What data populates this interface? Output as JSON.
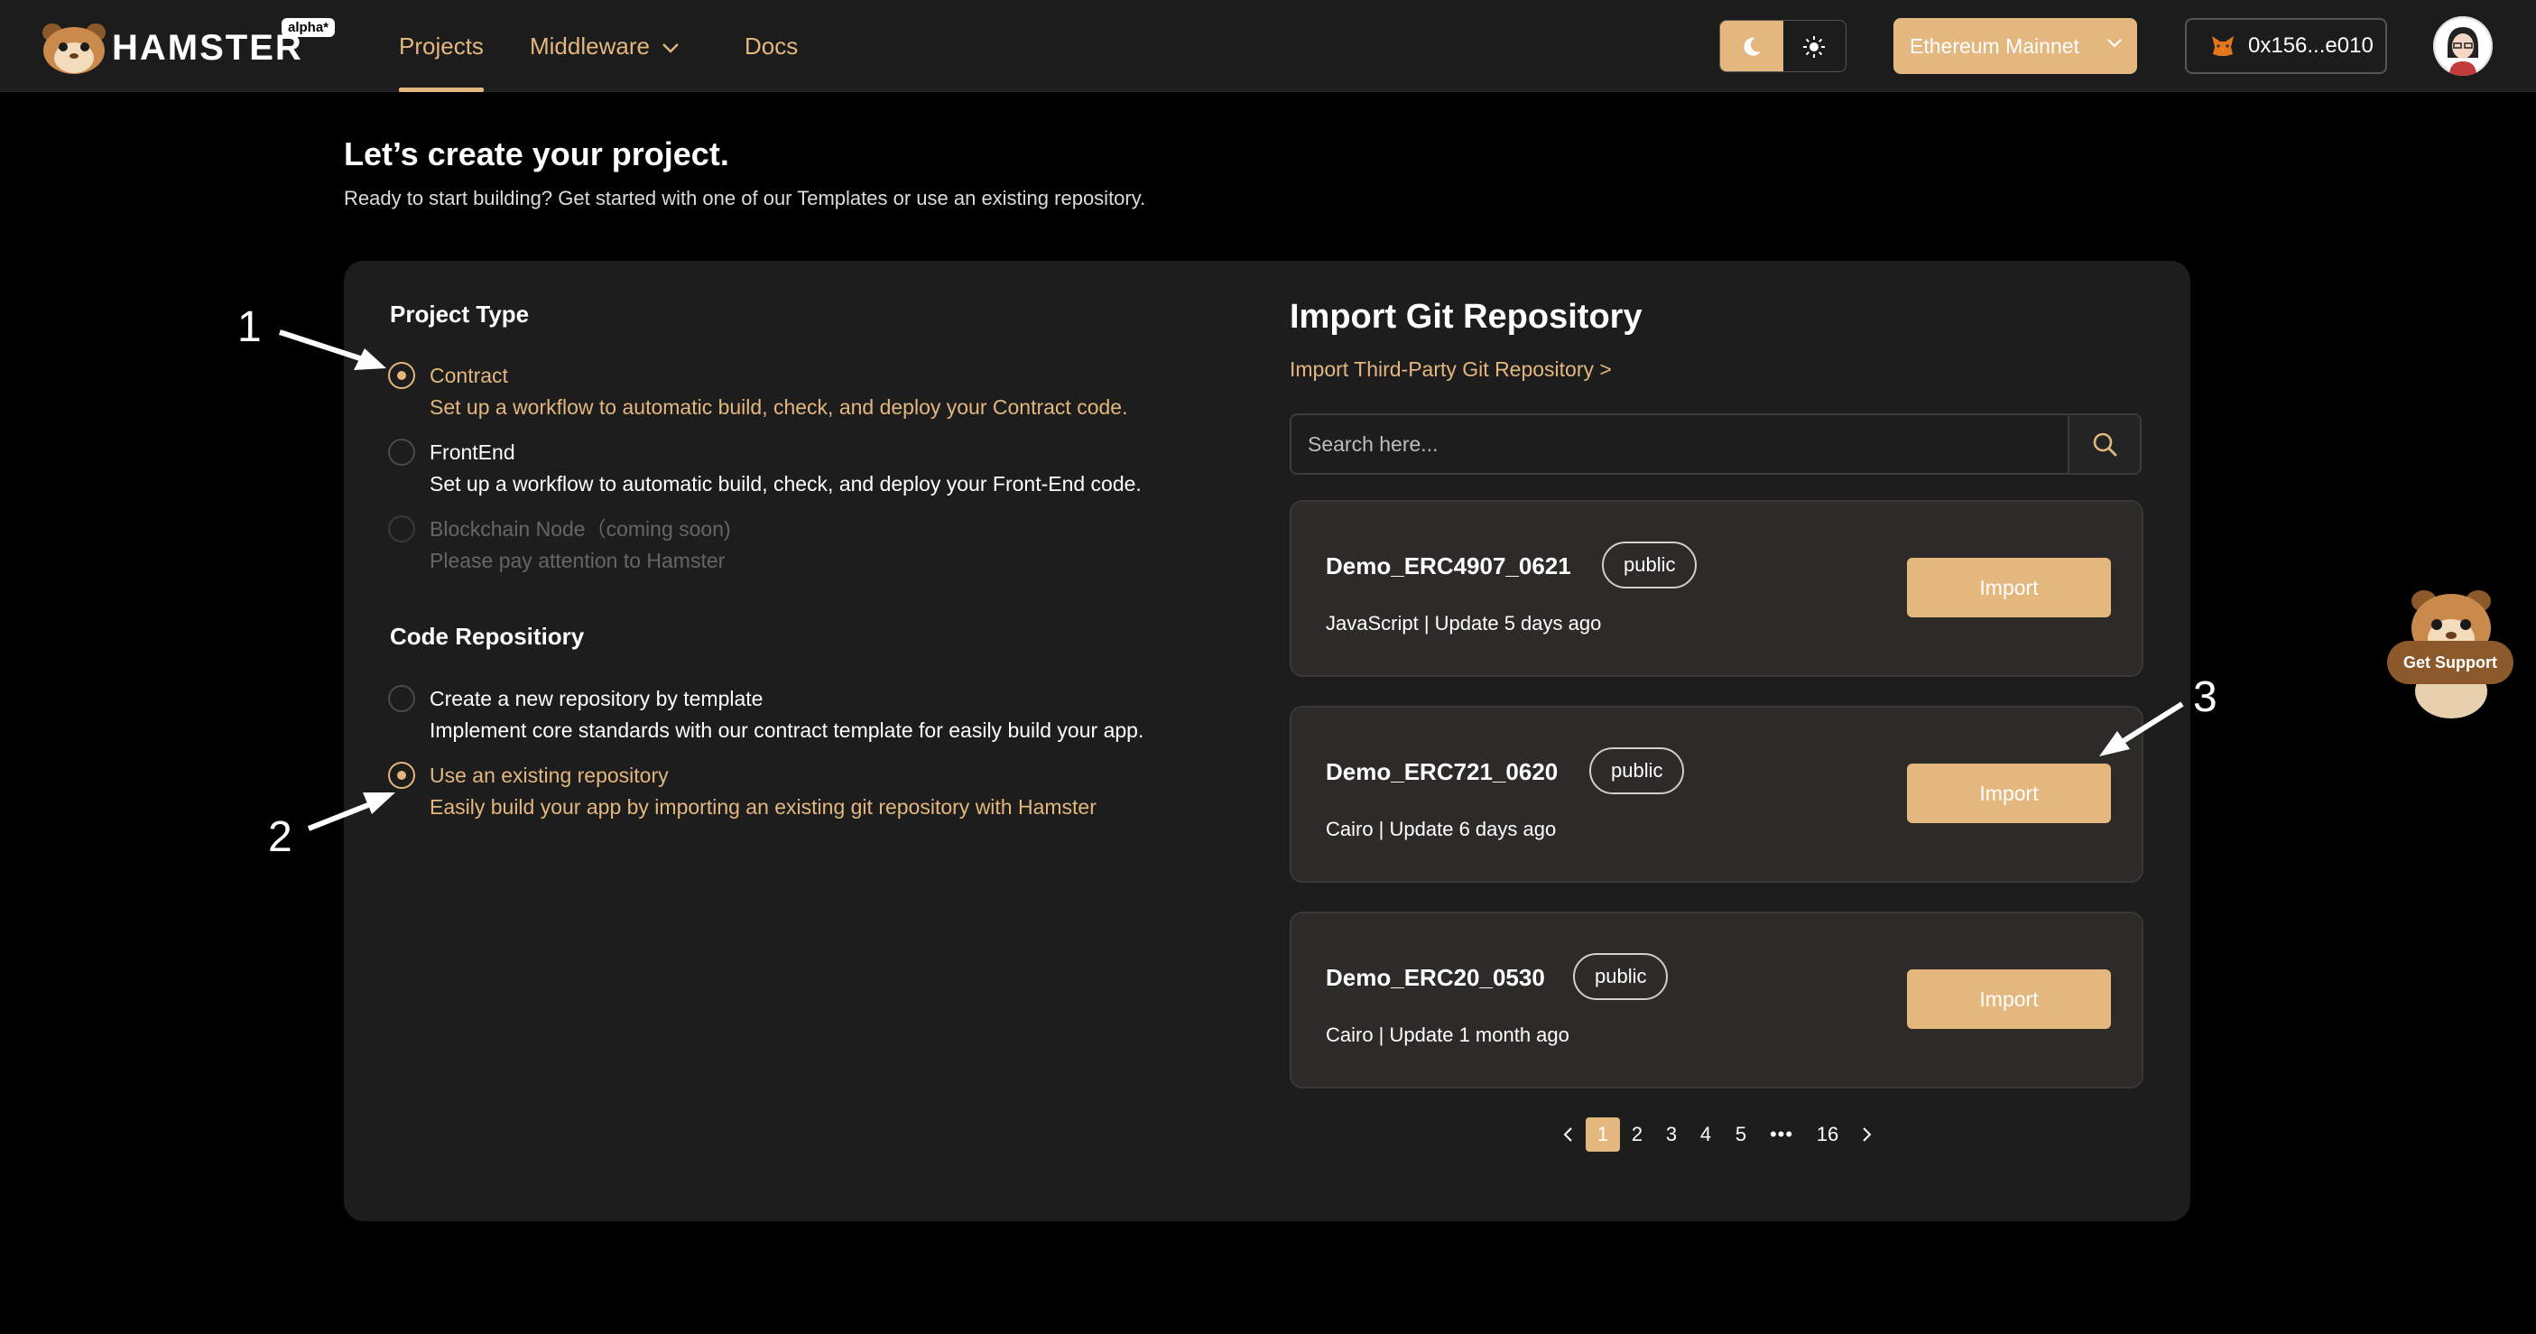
{
  "header": {
    "logo_text": "HAMSTER",
    "logo_badge": "alpha*",
    "nav": {
      "projects": "Projects",
      "middleware": "Middleware",
      "docs": "Docs"
    },
    "network": "Ethereum Mainnet",
    "wallet": "0x156...e010"
  },
  "page": {
    "title": "Let’s create your project.",
    "subtitle": "Ready to start building? Get started with one of our Templates or use an existing repository."
  },
  "project_type": {
    "title": "Project Type",
    "options": [
      {
        "label": "Contract",
        "desc": "Set up a workflow to automatic build, check, and deploy your Contract code.",
        "state": "selected"
      },
      {
        "label": "FrontEnd",
        "desc": "Set up a workflow to automatic build, check, and deploy your Front-End code.",
        "state": "normal"
      },
      {
        "label": "Blockchain Node（coming soon)",
        "desc": "Please pay attention to Hamster",
        "state": "disabled"
      }
    ]
  },
  "code_repository": {
    "title": "Code Repositiory",
    "options": [
      {
        "label": "Create a new repository by template",
        "desc": "Implement core standards with our contract template for easily build your app.",
        "state": "normal"
      },
      {
        "label": "Use an existing repository",
        "desc": "Easily build your app by importing an existing git repository with Hamster",
        "state": "selected"
      }
    ]
  },
  "import": {
    "title": "Import Git Repository",
    "third_party_link": "Import Third-Party Git Repository >",
    "search_placeholder": "Search here...",
    "repos": [
      {
        "name": "Demo_ERC4907_0621",
        "visibility": "public",
        "meta": "JavaScript | Update 5 days ago",
        "button": "Import"
      },
      {
        "name": "Demo_ERC721_0620",
        "visibility": "public",
        "meta": "Cairo | Update 6 days ago",
        "button": "Import"
      },
      {
        "name": "Demo_ERC20_0530",
        "visibility": "public",
        "meta": "Cairo | Update 1 month ago",
        "button": "Import"
      }
    ],
    "pagination": {
      "prev": "<",
      "pages": [
        "1",
        "2",
        "3",
        "4",
        "5"
      ],
      "ellipsis": "•••",
      "last": "16",
      "next": ">",
      "current": "1"
    }
  },
  "annotations": [
    "1",
    "2",
    "3"
  ],
  "support": {
    "label": "Get Support"
  },
  "colors": {
    "accent": "#e3b77e",
    "card_bg": "#1d1d1d",
    "repo_bg": "#2d2b28"
  },
  "icons": [
    "moon-icon",
    "sun-icon",
    "chevron-down-icon",
    "metamask-fox-icon",
    "search-icon",
    "chevron-left-icon",
    "chevron-right-icon"
  ]
}
